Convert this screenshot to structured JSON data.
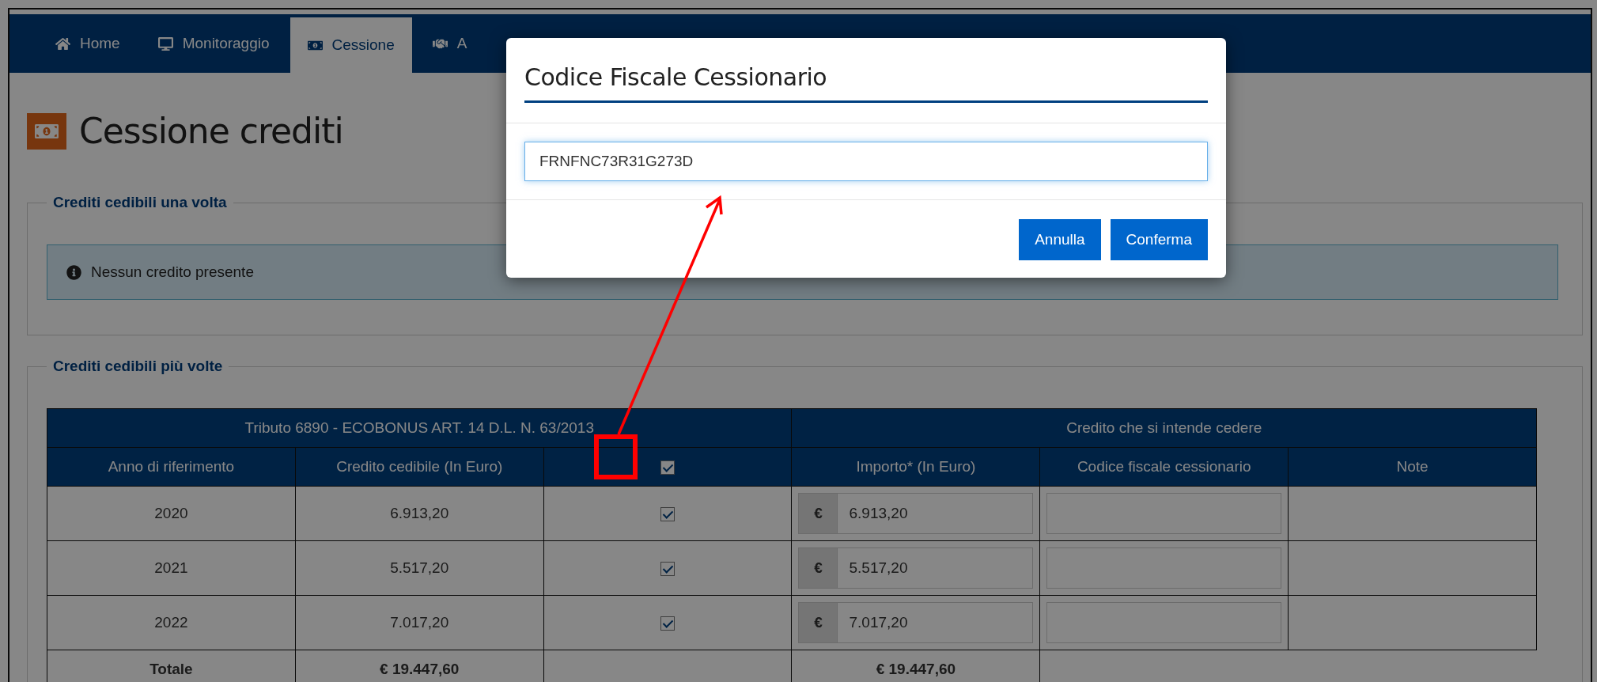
{
  "nav": {
    "tabs": [
      {
        "label": "Home",
        "kind": "home",
        "selected": false
      },
      {
        "label": "Monitoraggio",
        "kind": "monitor",
        "selected": false
      },
      {
        "label": "Cessione",
        "kind": "money",
        "selected": true
      },
      {
        "label": "A",
        "kind": "handshake",
        "selected": false
      }
    ]
  },
  "page": {
    "title": "Cessione crediti"
  },
  "section_once": {
    "legend": "Crediti cedibili una volta",
    "message": "Nessun credito presente"
  },
  "section_multi": {
    "legend": "Crediti cedibili più volte",
    "table": {
      "group_headers": [
        "Tributo 6890 - ECOBONUS ART. 14 D.L. N. 63/2013",
        "Credito che si intende cedere"
      ],
      "columns": [
        {
          "label": "Anno di riferimento",
          "kind": "text"
        },
        {
          "label": "Credito cedibile (In Euro)",
          "kind": "text"
        },
        {
          "kind": "checkbox"
        },
        {
          "label": "Importo* (In Euro)",
          "kind": "text"
        },
        {
          "label": "Codice fiscale cessionario",
          "kind": "text"
        },
        {
          "label": "Note",
          "kind": "text"
        }
      ],
      "select_all_checked": true,
      "rows": [
        {
          "year": "2020",
          "credit": "6.913,20",
          "checked": true,
          "currency": "€",
          "amount": "6.913,20"
        },
        {
          "year": "2021",
          "credit": "5.517,20",
          "checked": true,
          "currency": "€",
          "amount": "5.517,20"
        },
        {
          "year": "2022",
          "credit": "7.017,20",
          "checked": true,
          "currency": "€",
          "amount": "7.017,20"
        }
      ],
      "totals": {
        "label": "Totale",
        "credit": "€ 19.447,60",
        "amount": "€ 19.447,60"
      }
    }
  },
  "modal": {
    "title": "Codice Fiscale Cessionario",
    "value": "FRNFNC73R31G273D",
    "buttons": [
      "Annulla",
      "Conferma"
    ]
  }
}
